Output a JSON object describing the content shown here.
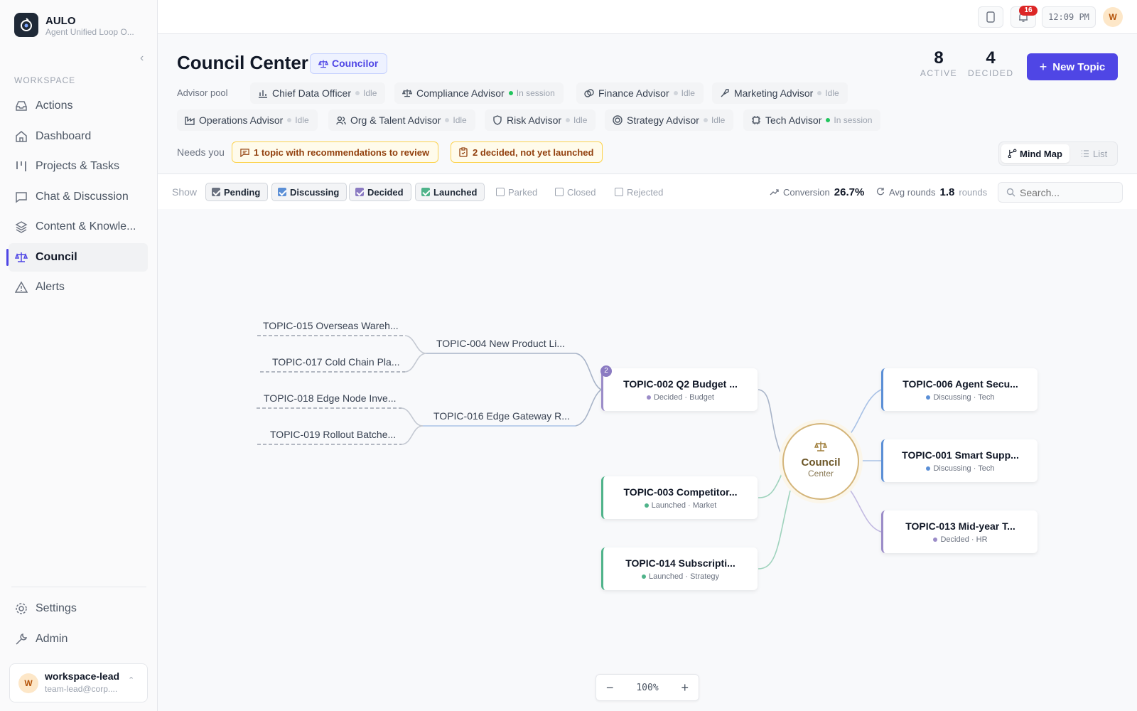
{
  "app": {
    "name": "AULO",
    "subtitle": "Agent Unified Loop O..."
  },
  "sidebar": {
    "section_label": "WORKSPACE",
    "items": [
      {
        "label": "Actions",
        "icon": "inbox-icon"
      },
      {
        "label": "Dashboard",
        "icon": "home-icon"
      },
      {
        "label": "Projects & Tasks",
        "icon": "kanban-icon"
      },
      {
        "label": "Chat & Discussion",
        "icon": "chat-icon"
      },
      {
        "label": "Content & Knowle...",
        "icon": "layers-icon"
      },
      {
        "label": "Council",
        "icon": "scales-icon",
        "active": true
      },
      {
        "label": "Alerts",
        "icon": "alert-icon"
      }
    ],
    "bottom_items": [
      {
        "label": "Settings",
        "icon": "gear-icon"
      },
      {
        "label": "Admin",
        "icon": "wrench-icon"
      }
    ],
    "user": {
      "initial": "W",
      "name": "workspace-lead",
      "email": "team-lead@corp...."
    }
  },
  "topbar": {
    "notification_count": "16",
    "time": "12:09 PM",
    "avatar_initial": "W"
  },
  "header": {
    "title": "Council Center",
    "role_badge": "Councilor",
    "stats": [
      {
        "value": "8",
        "label": "ACTIVE"
      },
      {
        "value": "4",
        "label": "DECIDED"
      }
    ],
    "new_topic_label": "New Topic"
  },
  "advisor_pool": {
    "label": "Advisor pool",
    "advisors": [
      {
        "name": "Chief Data Officer",
        "status": "Idle",
        "icon": "bar-chart-icon"
      },
      {
        "name": "Compliance Advisor",
        "status": "In session",
        "icon": "scales-icon"
      },
      {
        "name": "Finance Advisor",
        "status": "Idle",
        "icon": "coins-icon"
      },
      {
        "name": "Marketing Advisor",
        "status": "Idle",
        "icon": "rocket-icon"
      },
      {
        "name": "Operations Advisor",
        "status": "Idle",
        "icon": "factory-icon"
      },
      {
        "name": "Org & Talent Advisor",
        "status": "Idle",
        "icon": "users-icon"
      },
      {
        "name": "Risk Advisor",
        "status": "Idle",
        "icon": "shield-icon"
      },
      {
        "name": "Strategy Advisor",
        "status": "Idle",
        "icon": "target-icon"
      },
      {
        "name": "Tech Advisor",
        "status": "In session",
        "icon": "cpu-icon"
      }
    ]
  },
  "needs_you": {
    "label": "Needs you",
    "items": [
      {
        "text": "1 topic with recommendations to review",
        "icon": "message-icon"
      },
      {
        "text": "2 decided, not yet launched",
        "icon": "clipboard-icon"
      }
    ]
  },
  "view_toggle": {
    "mind_map": "Mind Map",
    "list": "List",
    "selected": "Mind Map"
  },
  "filters": {
    "label": "Show",
    "options": [
      {
        "label": "Pending",
        "checked": true
      },
      {
        "label": "Discussing",
        "checked": true
      },
      {
        "label": "Decided",
        "checked": true
      },
      {
        "label": "Launched",
        "checked": true
      },
      {
        "label": "Parked",
        "checked": false
      },
      {
        "label": "Closed",
        "checked": false
      },
      {
        "label": "Rejected",
        "checked": false
      }
    ]
  },
  "metrics": {
    "conversion_label": "Conversion",
    "conversion_value": "26.7%",
    "avg_rounds_label": "Avg rounds",
    "avg_rounds_value": "1.8",
    "avg_rounds_unit": "rounds"
  },
  "search": {
    "placeholder": "Search..."
  },
  "mindmap": {
    "center": {
      "title": "Council",
      "subtitle": "Center"
    },
    "left_nodes": [
      {
        "title": "TOPIC-002 Q2 Budget ...",
        "status": "Decided",
        "category": "Budget",
        "children_count": "2"
      },
      {
        "title": "TOPIC-003 Competitor...",
        "status": "Launched",
        "category": "Market"
      },
      {
        "title": "TOPIC-014 Subscripti...",
        "status": "Launched",
        "category": "Strategy"
      }
    ],
    "right_nodes": [
      {
        "title": "TOPIC-006 Agent Secu...",
        "status": "Discussing",
        "category": "Tech"
      },
      {
        "title": "TOPIC-001 Smart Supp...",
        "status": "Discussing",
        "category": "Tech"
      },
      {
        "title": "TOPIC-013 Mid-year T...",
        "status": "Decided",
        "category": "HR"
      }
    ],
    "branches": [
      {
        "title": "TOPIC-004 New Product Li...",
        "children": [
          "TOPIC-015 Overseas Wareh...",
          "TOPIC-017 Cold Chain Pla..."
        ]
      },
      {
        "title": "TOPIC-016 Edge Gateway R...",
        "children": [
          "TOPIC-018 Edge Node Inve...",
          "TOPIC-019 Rollout Batche..."
        ]
      }
    ]
  },
  "zoom": {
    "level": "100%"
  },
  "colors": {
    "accent": "#4f46e5",
    "decided": "#9b8cc8",
    "launched": "#4fb38a",
    "discussing": "#5b8fd6",
    "session": "#22c55e",
    "center": "#d4b57a"
  }
}
